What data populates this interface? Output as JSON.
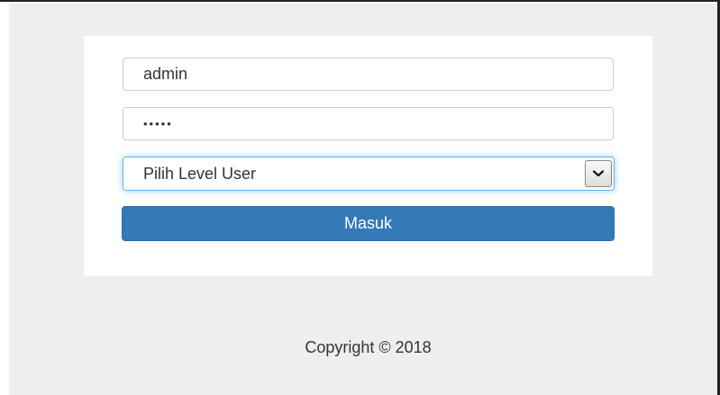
{
  "login_form": {
    "username_value": "admin",
    "password_value": "•••••",
    "level_select": {
      "selected": "Pilih Level User"
    },
    "submit_label": "Masuk"
  },
  "footer": {
    "copyright": "Copyright © 2018"
  },
  "colors": {
    "page_background": "#eeeeee",
    "card_background": "#ffffff",
    "primary_button": "#337ab7",
    "focus_border": "#66afe9"
  },
  "icons": {
    "select_arrow": "chevron-down-icon"
  }
}
